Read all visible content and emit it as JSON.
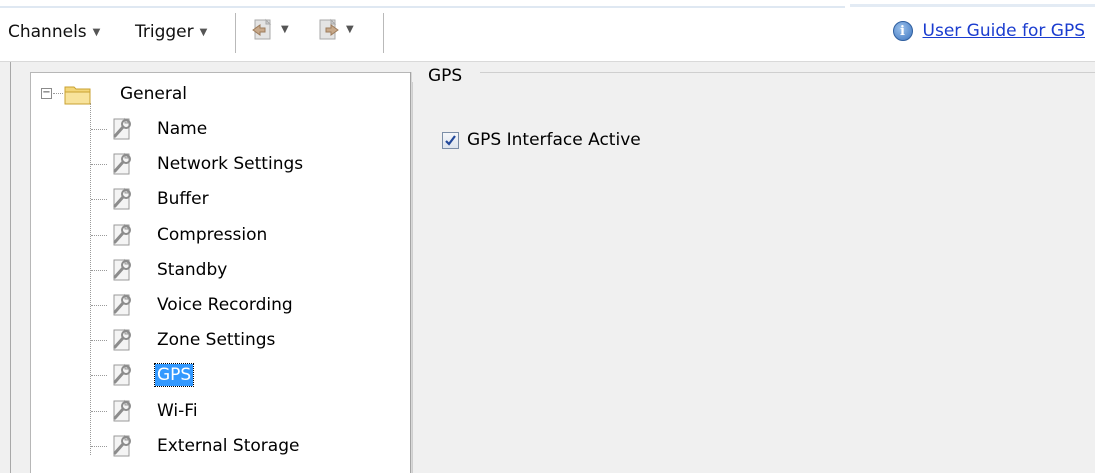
{
  "toolbar": {
    "channels_label": "Channels",
    "trigger_label": "Trigger",
    "dropdown_arrow": "▼",
    "import_icon": "import-config-icon",
    "export_icon": "export-config-icon"
  },
  "help": {
    "icon": "info-icon",
    "icon_glyph": "i",
    "link_text": "User Guide for GPS"
  },
  "tree": {
    "root": {
      "label": "General",
      "expander": "−",
      "icon": "folder-icon"
    },
    "items": [
      {
        "label": "Name",
        "icon": "wrench-page-icon"
      },
      {
        "label": "Network Settings",
        "icon": "wrench-page-icon"
      },
      {
        "label": "Buffer",
        "icon": "wrench-page-icon"
      },
      {
        "label": "Compression",
        "icon": "wrench-page-icon"
      },
      {
        "label": "Standby",
        "icon": "wrench-page-icon"
      },
      {
        "label": "Voice Recording",
        "icon": "wrench-page-icon"
      },
      {
        "label": "Zone Settings",
        "icon": "wrench-page-icon"
      },
      {
        "label": "GPS",
        "icon": "wrench-page-icon",
        "selected": true
      },
      {
        "label": "Wi-Fi",
        "icon": "wrench-page-icon"
      },
      {
        "label": "External Storage",
        "icon": "wrench-page-icon"
      }
    ]
  },
  "panel": {
    "group_title": "GPS",
    "gps_active": {
      "label": "GPS Interface Active",
      "checked": true
    }
  },
  "colors": {
    "selection": "#3399ff",
    "link": "#1a3ccf",
    "panel_bg": "#f0f0f0"
  }
}
